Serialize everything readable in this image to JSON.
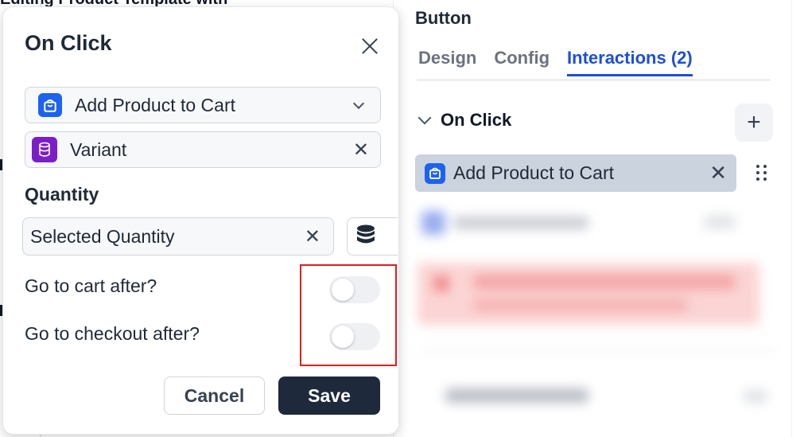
{
  "background": {
    "page_title": "Editing Product Template with"
  },
  "panel": {
    "title": "Button",
    "tabs": [
      {
        "label": "Design",
        "active": false
      },
      {
        "label": "Config",
        "active": false
      },
      {
        "label": "Interactions (2)",
        "active": true
      }
    ],
    "section_label": "On Click",
    "add_button_icon": "plus-icon",
    "action": {
      "label": "Add Product to Cart",
      "icon": "shopping-bag-icon"
    }
  },
  "modal": {
    "title": "On Click",
    "action_select": {
      "value": "Add Product to Cart",
      "icon": "shopping-bag-icon"
    },
    "variant_field": {
      "value": "Variant",
      "icon": "database-icon"
    },
    "quantity_label": "Quantity",
    "quantity_field": {
      "value": "Selected Quantity"
    },
    "toggles": [
      {
        "label": "Go to cart after?",
        "on": false
      },
      {
        "label": "Go to checkout after?",
        "on": false
      }
    ],
    "cancel_label": "Cancel",
    "save_label": "Save"
  },
  "colors": {
    "accent": "#1d4ed8",
    "primary_button": "#1e293b",
    "highlight": "#e01e1e",
    "purple_icon": "#7c1ec8",
    "blue_icon": "#1d62f0"
  }
}
